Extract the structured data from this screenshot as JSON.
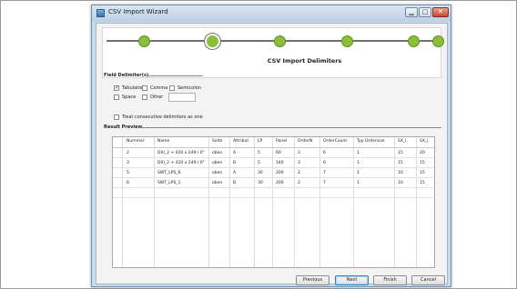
{
  "window": {
    "title": "CSV Import Wizard",
    "minimize": "▁",
    "maximize": "□",
    "close": "✕"
  },
  "stepper": {
    "current_title": "CSV Import Delimiters",
    "steps": 6,
    "active_index": 1
  },
  "field_delimiters": {
    "title": "Field Delimiter(s)",
    "options": [
      {
        "label": "Tabulator",
        "checked": true
      },
      {
        "label": "Comma",
        "checked": false
      },
      {
        "label": "Semicolon",
        "checked": false
      },
      {
        "label": "Space",
        "checked": false
      },
      {
        "label": "Other",
        "checked": false
      }
    ],
    "other_value": "",
    "treat_consecutive_label": "Treat consecutive delimiters as one",
    "treat_consecutive_checked": false
  },
  "result_preview": {
    "title": "Result Preview",
    "columns": [
      "Nummer",
      "Name",
      "Seite",
      "Attribut",
      "LP",
      "Panel",
      "OrderN",
      "OrderCount",
      "Typ Ordersize",
      "SX_l",
      "SX_l"
    ],
    "rows": [
      [
        "2",
        "DXI_2 + 420 x 249 / 0°",
        "oben",
        "A",
        "5",
        "60",
        "3",
        "6",
        "1",
        "15",
        "20"
      ],
      [
        "3",
        "DXI_2 + 420 x 249 / 0°",
        "oben",
        "B",
        "5",
        "140",
        "3",
        "6",
        "1",
        "15",
        "15"
      ],
      [
        "5",
        "SWT_LPS_6",
        "oben",
        "A",
        "30",
        "200",
        "2",
        "7",
        "1",
        "10",
        "15"
      ],
      [
        "6",
        "SWT_LPS_1",
        "oben",
        "B",
        "30",
        "200",
        "2",
        "7",
        "1",
        "10",
        "15"
      ]
    ]
  },
  "buttons": {
    "previous": "Previous",
    "next": "Next",
    "finish": "Finish",
    "cancel": "Cancel"
  }
}
